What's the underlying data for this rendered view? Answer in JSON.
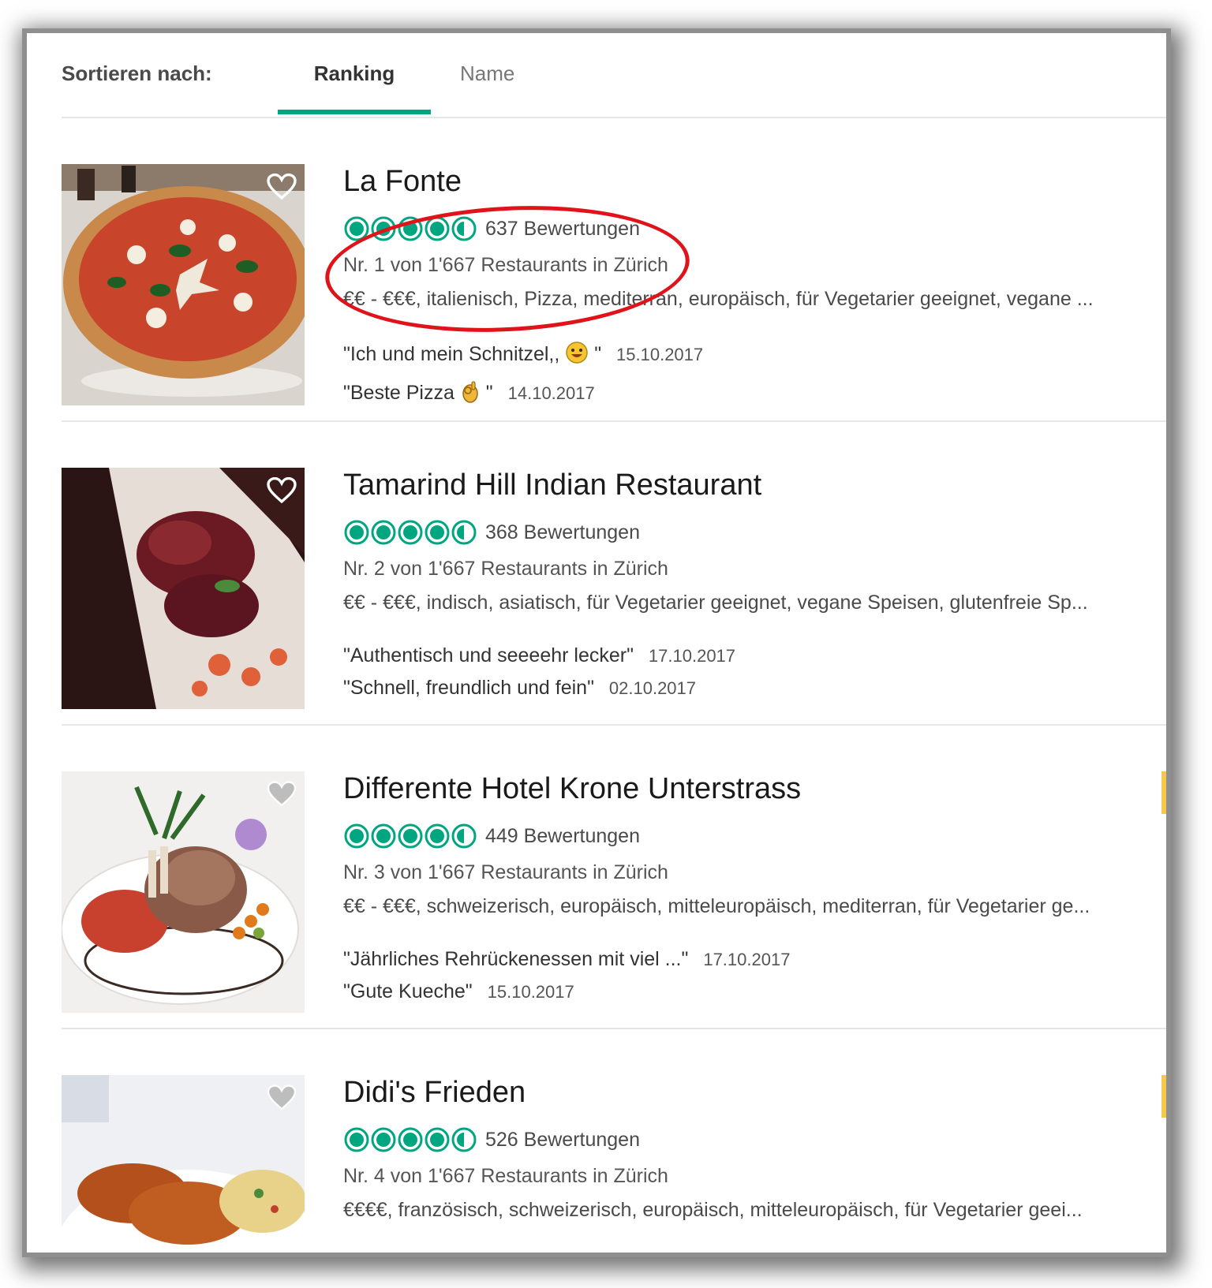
{
  "sort": {
    "label": "Sortieren nach:",
    "tabs": [
      "Ranking",
      "Name"
    ],
    "active": "Ranking"
  },
  "colors": {
    "accent": "#00a680",
    "annotation_circle": "#e0131b",
    "yellow_marker": "#f2c94c"
  },
  "restaurants": [
    {
      "name": "La Fonte",
      "rating": 4.5,
      "reviews": "637 Bewertungen",
      "rank": "Nr. 1 von 1'667 Restaurants in Zürich",
      "cuisine": "€€ - €€€, italienisch, Pizza, mediterran, europäisch, für Vegetarier geeignet, vegane ...",
      "image": "pizza-photo",
      "review_items": [
        {
          "quote": "\"Ich und mein Schnitzel,,",
          "emoji": "grinning-face",
          "close": "\"",
          "date": "15.10.2017"
        },
        {
          "quote": "\"Beste Pizza",
          "emoji": "ok-hand",
          "close": "\"",
          "date": "14.10.2017"
        }
      ]
    },
    {
      "name": "Tamarind Hill Indian Restaurant",
      "rating": 4.5,
      "reviews": "368 Bewertungen",
      "rank": "Nr. 2 von 1'667 Restaurants in Zürich",
      "cuisine": "€€ - €€€, indisch, asiatisch, für Vegetarier geeignet, vegane Speisen, glutenfreie Sp...",
      "image": "indian-dish-photo",
      "review_items": [
        {
          "quote": "\"Authentisch und seeeehr lecker\"",
          "date": "17.10.2017"
        },
        {
          "quote": "\"Schnell, freundlich und fein\"",
          "date": "02.10.2017"
        }
      ]
    },
    {
      "name": "Differente Hotel Krone Unterstrass",
      "rating": 4.5,
      "reviews": "449 Bewertungen",
      "rank": "Nr. 3 von 1'667 Restaurants in Zürich",
      "cuisine": "€€ - €€€, schweizerisch, europäisch, mitteleuropäisch, mediterran, für Vegetarier ge...",
      "image": "rack-of-lamb-photo",
      "review_items": [
        {
          "quote": "\"Jährliches Rehrückenessen mit viel ...\"",
          "date": "17.10.2017"
        },
        {
          "quote": "\"Gute Kueche\"",
          "date": "15.10.2017"
        }
      ]
    },
    {
      "name": "Didi's Frieden",
      "rating": 4.5,
      "reviews": "526 Bewertungen",
      "rank": "Nr. 4 von 1'667 Restaurants in Zürich",
      "cuisine": "€€€€, französisch, schweizerisch, europäisch, mitteleuropäisch, für Vegetarier geei...",
      "image": "schnitzel-photo",
      "review_items": []
    }
  ]
}
